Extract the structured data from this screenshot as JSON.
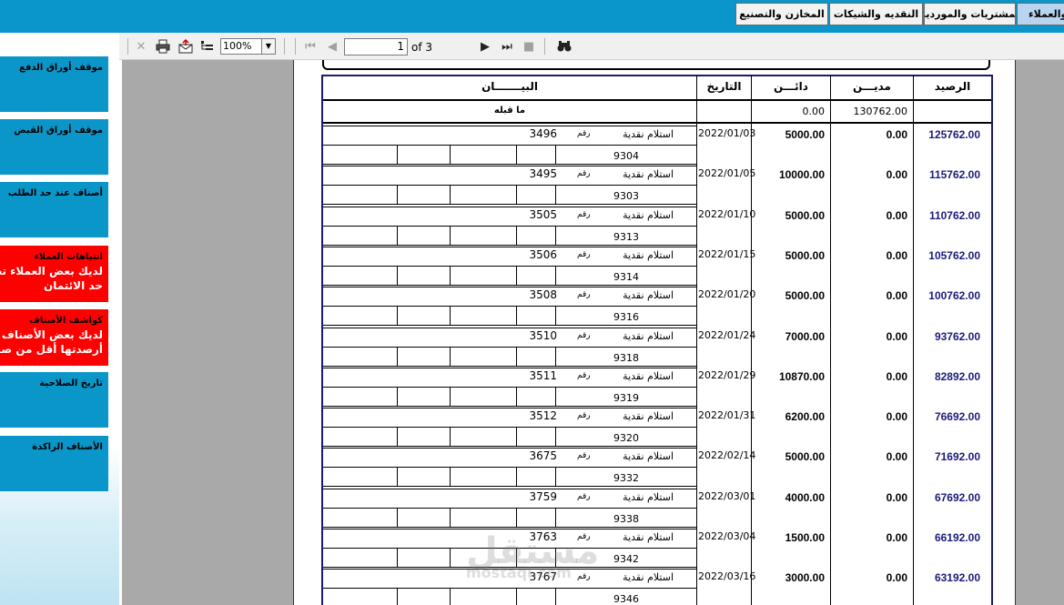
{
  "menu": {
    "items": [
      {
        "label": "والعملاء"
      },
      {
        "label": "المشتريات والموردين"
      },
      {
        "label": "النقديه والشيكات"
      },
      {
        "label": "المخازن والتصنيع"
      }
    ]
  },
  "sidebar": {
    "tiles": [
      {
        "title": "موقف أوراق الدفع",
        "warning": ""
      },
      {
        "title": "موقف أوراق القبض",
        "warning": ""
      },
      {
        "title": "أصناف عند حد الطلب",
        "warning": ""
      },
      {
        "title": "انتباهات العملاء",
        "warning": "لديك بعض العملاء تجاوزوا حد الائتمان"
      },
      {
        "title": "كواشف الأصناف",
        "warning": "لديك بعض الأصناف أرصدتها أقل من صفر"
      },
      {
        "title": "تاريخ الصلاحية",
        "warning": ""
      },
      {
        "title": "الأصناف الراكدة",
        "warning": ""
      }
    ]
  },
  "viewer": {
    "zoom": "100%",
    "current_page": "1",
    "page_total_label": "of 3",
    "icons": [
      "close-icon",
      "print-icon",
      "export-icon",
      "tree-icon",
      "first-page-icon",
      "prev-page-icon",
      "next-page-icon",
      "last-page-icon",
      "stop-icon",
      "find-icon"
    ]
  },
  "report": {
    "headers": {
      "description": "البيـــــــان",
      "date": "التاريخ",
      "credit": "دائـــن",
      "debit": "مديـــن",
      "balance": "الرصيد"
    },
    "opening": {
      "label": "ما قبله",
      "credit": "0.00",
      "debit": "130762.00"
    },
    "doc_prefix": "رقم",
    "rows": [
      {
        "desc": "استلام نقدية",
        "doc": "3496",
        "ref": "9304",
        "date": "2022/01/03",
        "credit": "5000.00",
        "debit": "0.00",
        "balance": "125762.00"
      },
      {
        "desc": "استلام نقدية",
        "doc": "3495",
        "ref": "9303",
        "date": "2022/01/05",
        "credit": "10000.00",
        "debit": "0.00",
        "balance": "115762.00"
      },
      {
        "desc": "استلام نقدية",
        "doc": "3505",
        "ref": "9313",
        "date": "2022/01/10",
        "credit": "5000.00",
        "debit": "0.00",
        "balance": "110762.00"
      },
      {
        "desc": "استلام نقدية",
        "doc": "3506",
        "ref": "9314",
        "date": "2022/01/15",
        "credit": "5000.00",
        "debit": "0.00",
        "balance": "105762.00"
      },
      {
        "desc": "استلام نقدية",
        "doc": "3508",
        "ref": "9316",
        "date": "2022/01/20",
        "credit": "5000.00",
        "debit": "0.00",
        "balance": "100762.00"
      },
      {
        "desc": "استلام نقدية",
        "doc": "3510",
        "ref": "9318",
        "date": "2022/01/24",
        "credit": "7000.00",
        "debit": "0.00",
        "balance": "93762.00"
      },
      {
        "desc": "استلام نقدية",
        "doc": "3511",
        "ref": "9319",
        "date": "2022/01/29",
        "credit": "10870.00",
        "debit": "0.00",
        "balance": "82892.00"
      },
      {
        "desc": "استلام نقدية",
        "doc": "3512",
        "ref": "9320",
        "date": "2022/01/31",
        "credit": "6200.00",
        "debit": "0.00",
        "balance": "76692.00"
      },
      {
        "desc": "استلام نقدية",
        "doc": "3675",
        "ref": "9332",
        "date": "2022/02/14",
        "credit": "5000.00",
        "debit": "0.00",
        "balance": "71692.00"
      },
      {
        "desc": "استلام نقدية",
        "doc": "3759",
        "ref": "9338",
        "date": "2022/03/01",
        "credit": "4000.00",
        "debit": "0.00",
        "balance": "67692.00"
      },
      {
        "desc": "استلام نقدية",
        "doc": "3763",
        "ref": "9342",
        "date": "2022/03/04",
        "credit": "1500.00",
        "debit": "0.00",
        "balance": "66192.00"
      },
      {
        "desc": "استلام نقدية",
        "doc": "3767",
        "ref": "9346",
        "date": "2022/03/16",
        "credit": "3000.00",
        "debit": "0.00",
        "balance": "63192.00"
      }
    ]
  },
  "watermark": {
    "arabic": "مستقل",
    "latin": "mostaql.com"
  }
}
